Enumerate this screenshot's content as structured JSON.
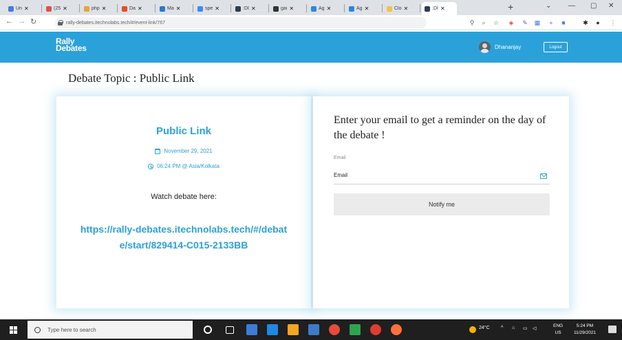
{
  "browser": {
    "tabs": [
      {
        "label": "Un",
        "color": "#4a7bd9"
      },
      {
        "label": "(25",
        "color": "#e34d4d"
      },
      {
        "label": "php",
        "color": "#e8a33a"
      },
      {
        "label": "Da",
        "color": "#e94e1b"
      },
      {
        "label": "Ma",
        "color": "#2979c9"
      },
      {
        "label": "spe",
        "color": "#4285f4"
      },
      {
        "label": ":DI",
        "color": "#2c3e50"
      },
      {
        "label": "gai",
        "color": "#333333"
      },
      {
        "label": "Ag",
        "color": "#2d88d9"
      },
      {
        "label": "Ag",
        "color": "#2d88d9"
      },
      {
        "label": "Clo",
        "color": "#f2c14e"
      },
      {
        "label": ":DI",
        "color": "#2c3e50"
      }
    ],
    "url": "rally-debates.itechnolabs.tech/#/event-link/767"
  },
  "header": {
    "logo_line1": "Rally",
    "logo_line2": "Debates",
    "username": "Dhananjay",
    "logout_label": "Logout",
    "accent": "#2ba1da"
  },
  "page": {
    "title": "Debate Topic : Public Link"
  },
  "event": {
    "title": "Public Link",
    "date": "November 29, 2021",
    "time": "06:24 PM @ Asia/Kolkata",
    "watch_label": "Watch debate here:",
    "debate_link": "https://rally-debates.itechnolabs.tech/#/debate/start/829414-C015-2133BB"
  },
  "reminder": {
    "heading": "Enter your email to get a reminder on the day of the debate !",
    "email_label": "Email",
    "email_placeholder": "Email",
    "button_label": "Notify me"
  },
  "taskbar": {
    "search_placeholder": "Type here to search",
    "weather": "24°C",
    "lang_line1": "ENG",
    "lang_line2": "US",
    "time": "5:24 PM",
    "date": "11/29/2021"
  }
}
